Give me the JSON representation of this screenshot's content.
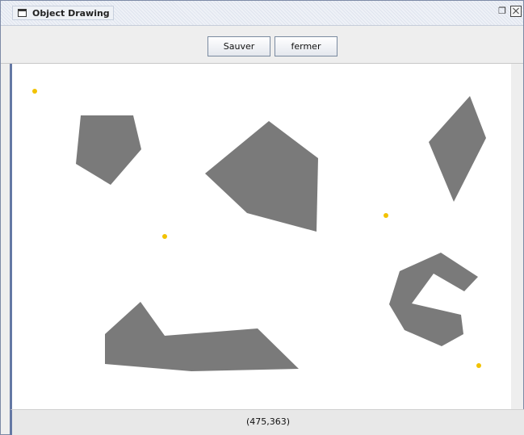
{
  "window": {
    "title": "Object Drawing",
    "restore_glyph": "⁽ᶦ",
    "icons": [
      "window-icon",
      "restore-icon",
      "close-icon"
    ]
  },
  "toolbar": {
    "save_label": "Sauver",
    "close_label": "fermer"
  },
  "status": {
    "coordinates": "(475,363)"
  },
  "colors": {
    "shape_fill": "#7a7a7a",
    "point_fill": "#f2c200",
    "canvas_bg": "#ffffff",
    "frame_accent": "#6478a4"
  }
}
